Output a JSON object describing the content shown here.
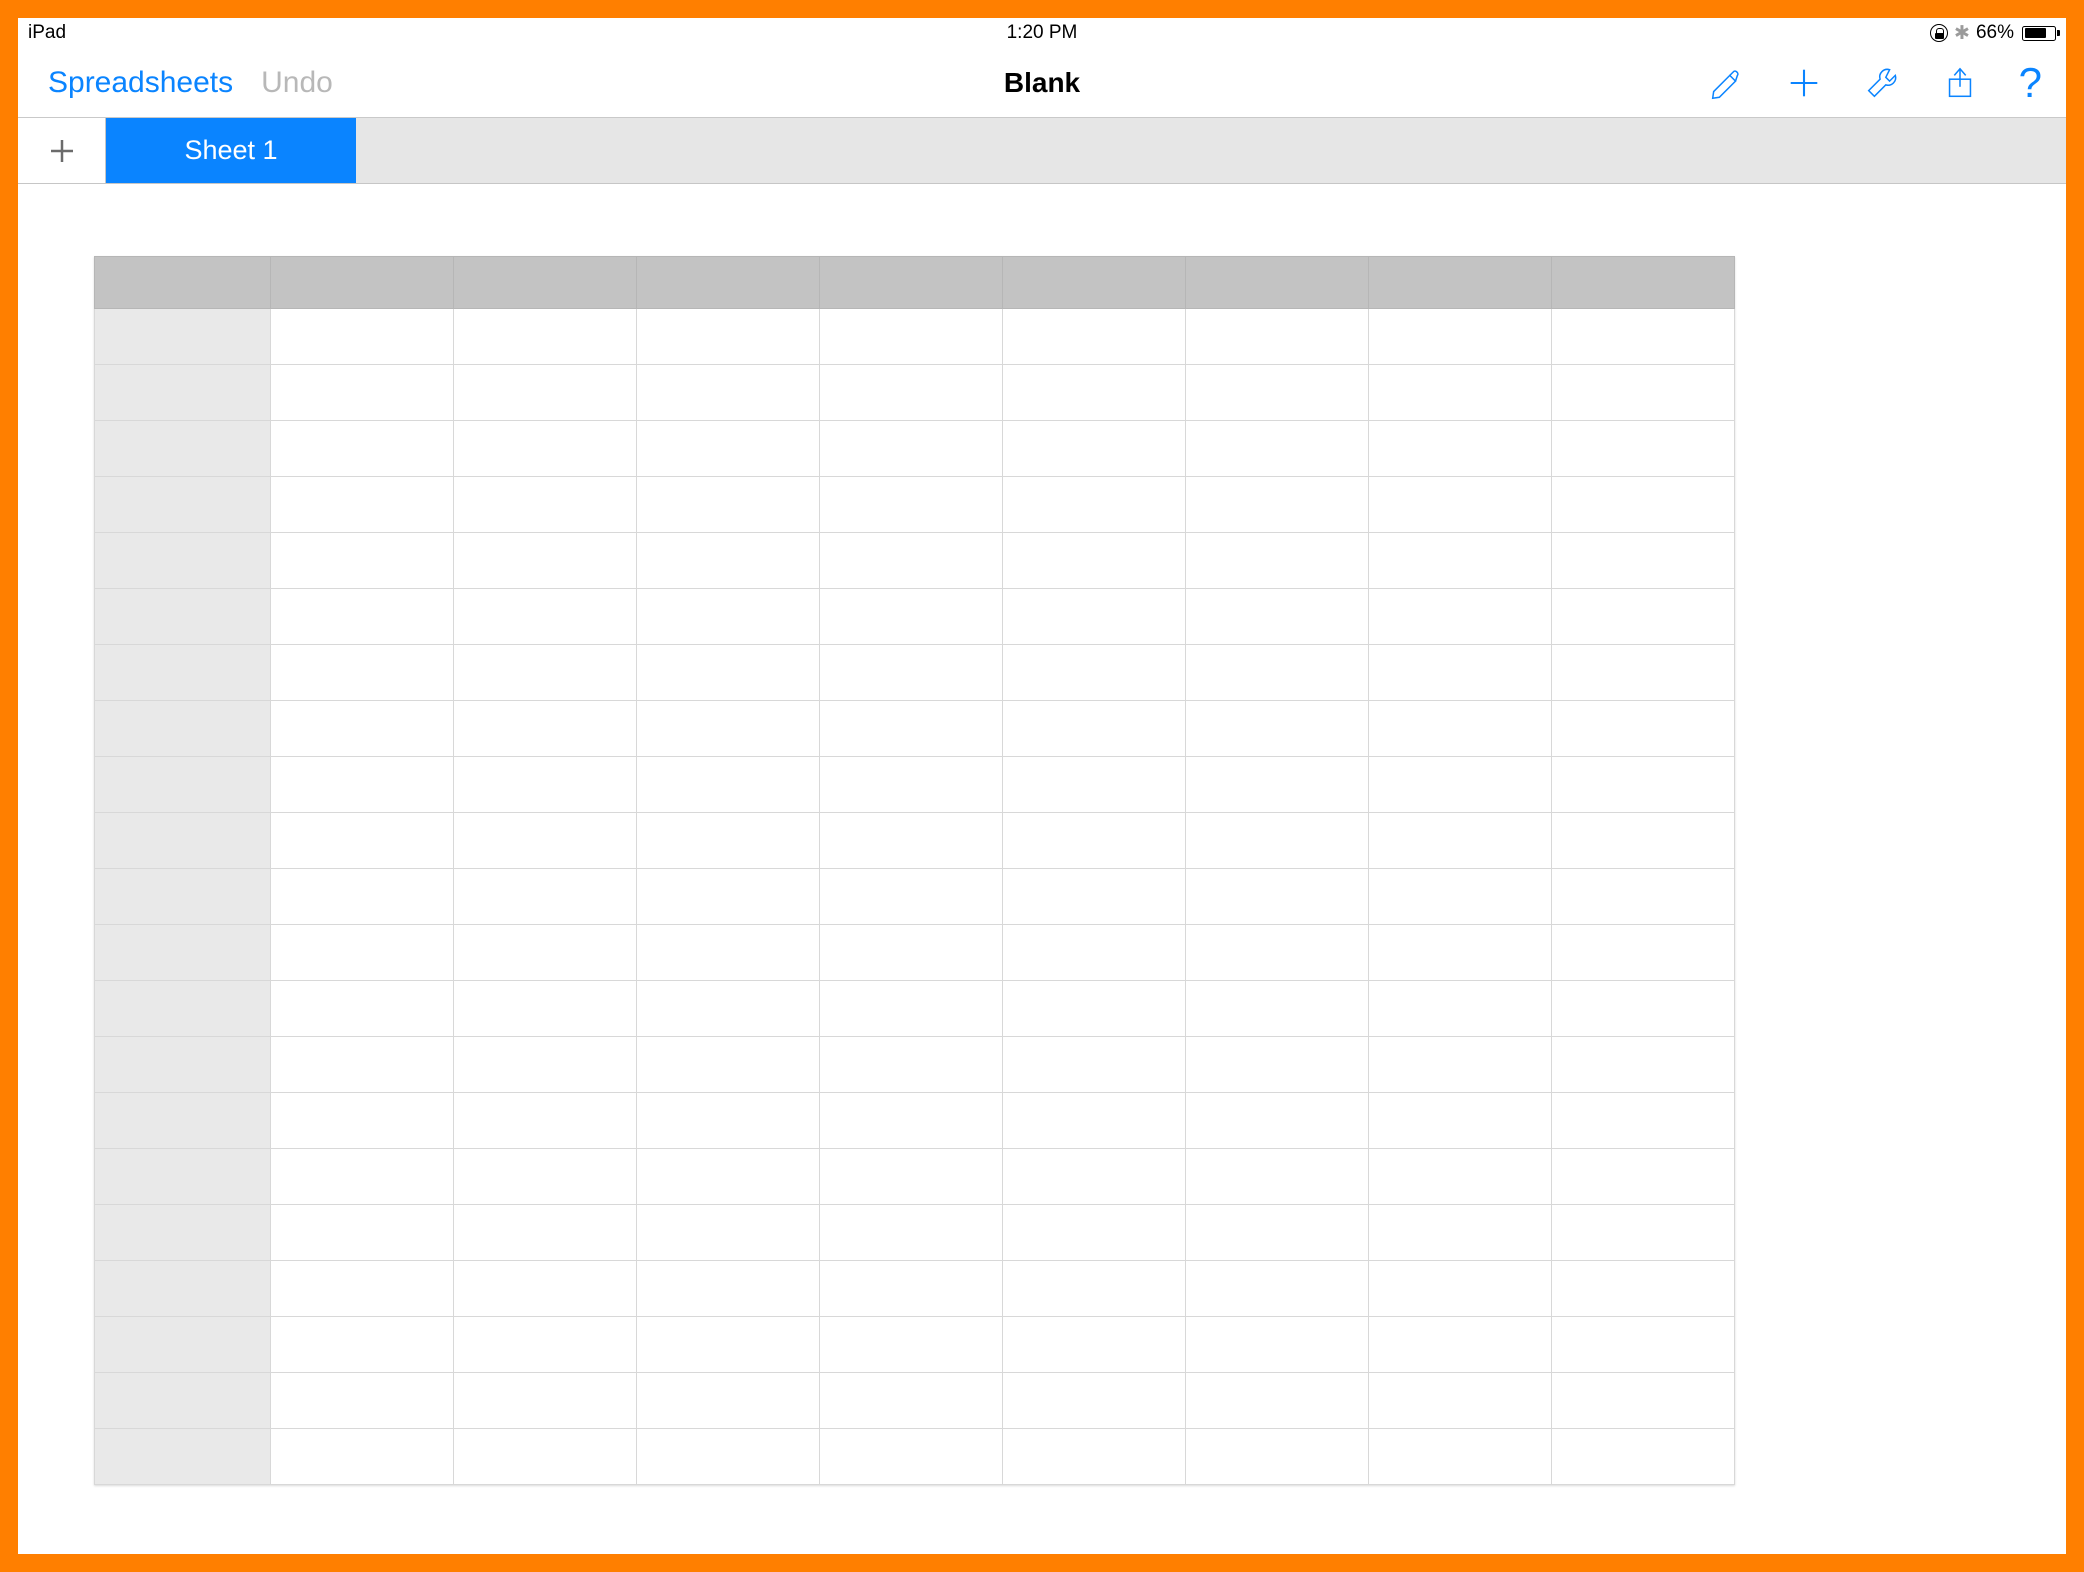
{
  "status": {
    "device": "iPad",
    "time": "1:20 PM",
    "battery_pct": "66%"
  },
  "toolbar": {
    "back_label": "Spreadsheets",
    "undo_label": "Undo",
    "title": "Blank"
  },
  "tabs": {
    "active_sheet": "Sheet 1"
  },
  "grid": {
    "columns": 8,
    "rows": 21
  },
  "colors": {
    "accent": "#0a84ff",
    "frame": "#ff7f00"
  }
}
